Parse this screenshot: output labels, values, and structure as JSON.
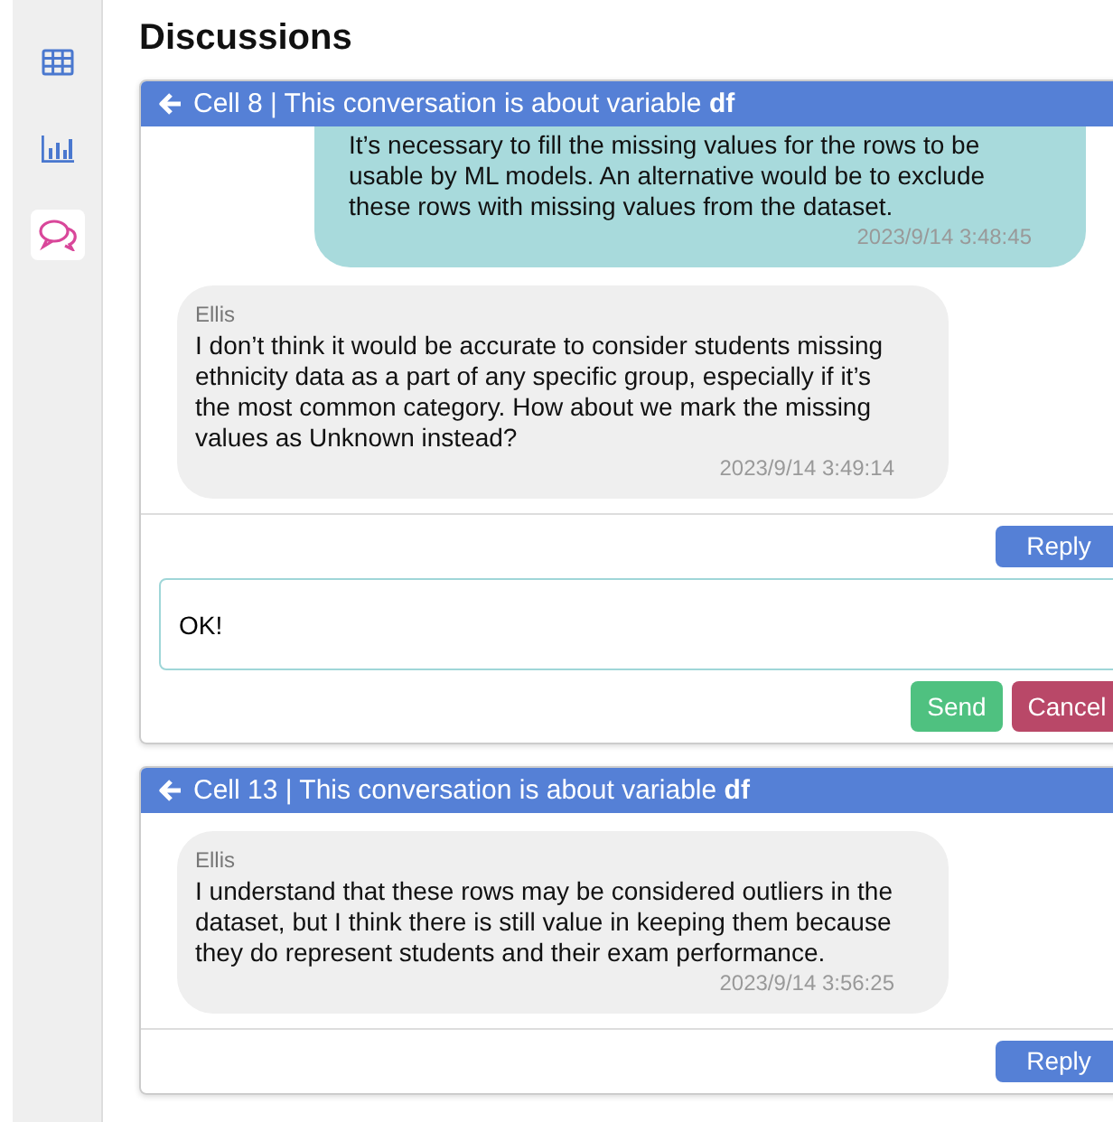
{
  "sidebar": {
    "items": [
      {
        "kind": "table",
        "selected": false
      },
      {
        "kind": "chart",
        "selected": false
      },
      {
        "kind": "chat",
        "selected": true
      }
    ]
  },
  "title": "Discussions",
  "discussions": [
    {
      "header": "Cell 8 | This conversation is about variable **df**",
      "messages": [
        {
          "kind": "own",
          "text": "It’s necessary to fill the missing values for the rows to be usable by ML models. An alternative would be to exclude these rows with missing values from the dataset.",
          "time": "2023/9/14 3:48:45"
        },
        {
          "kind": "other",
          "author": "Ellis",
          "text": "I don’t think it would be accurate to consider students missing ethnicity data as a part of any specific group, especially if it’s the most common category. How about we mark the missing values as Unknown instead?",
          "time": "2023/9/14 3:49:14"
        }
      ],
      "reply_button": "Reply",
      "reply_form": {
        "value": "OK!",
        "send": "Send",
        "cancel": "Cancel"
      }
    },
    {
      "header": "Cell 13 | This conversation is about variable **df**",
      "messages": [
        {
          "kind": "other",
          "author": "Ellis",
          "text": "I understand that these rows may be considered outliers in the dataset, but I think there is still value in keeping them because they do represent students and their exam performance.",
          "time": "2023/9/14 3:56:25"
        }
      ],
      "reply_button": "Reply"
    }
  ]
}
